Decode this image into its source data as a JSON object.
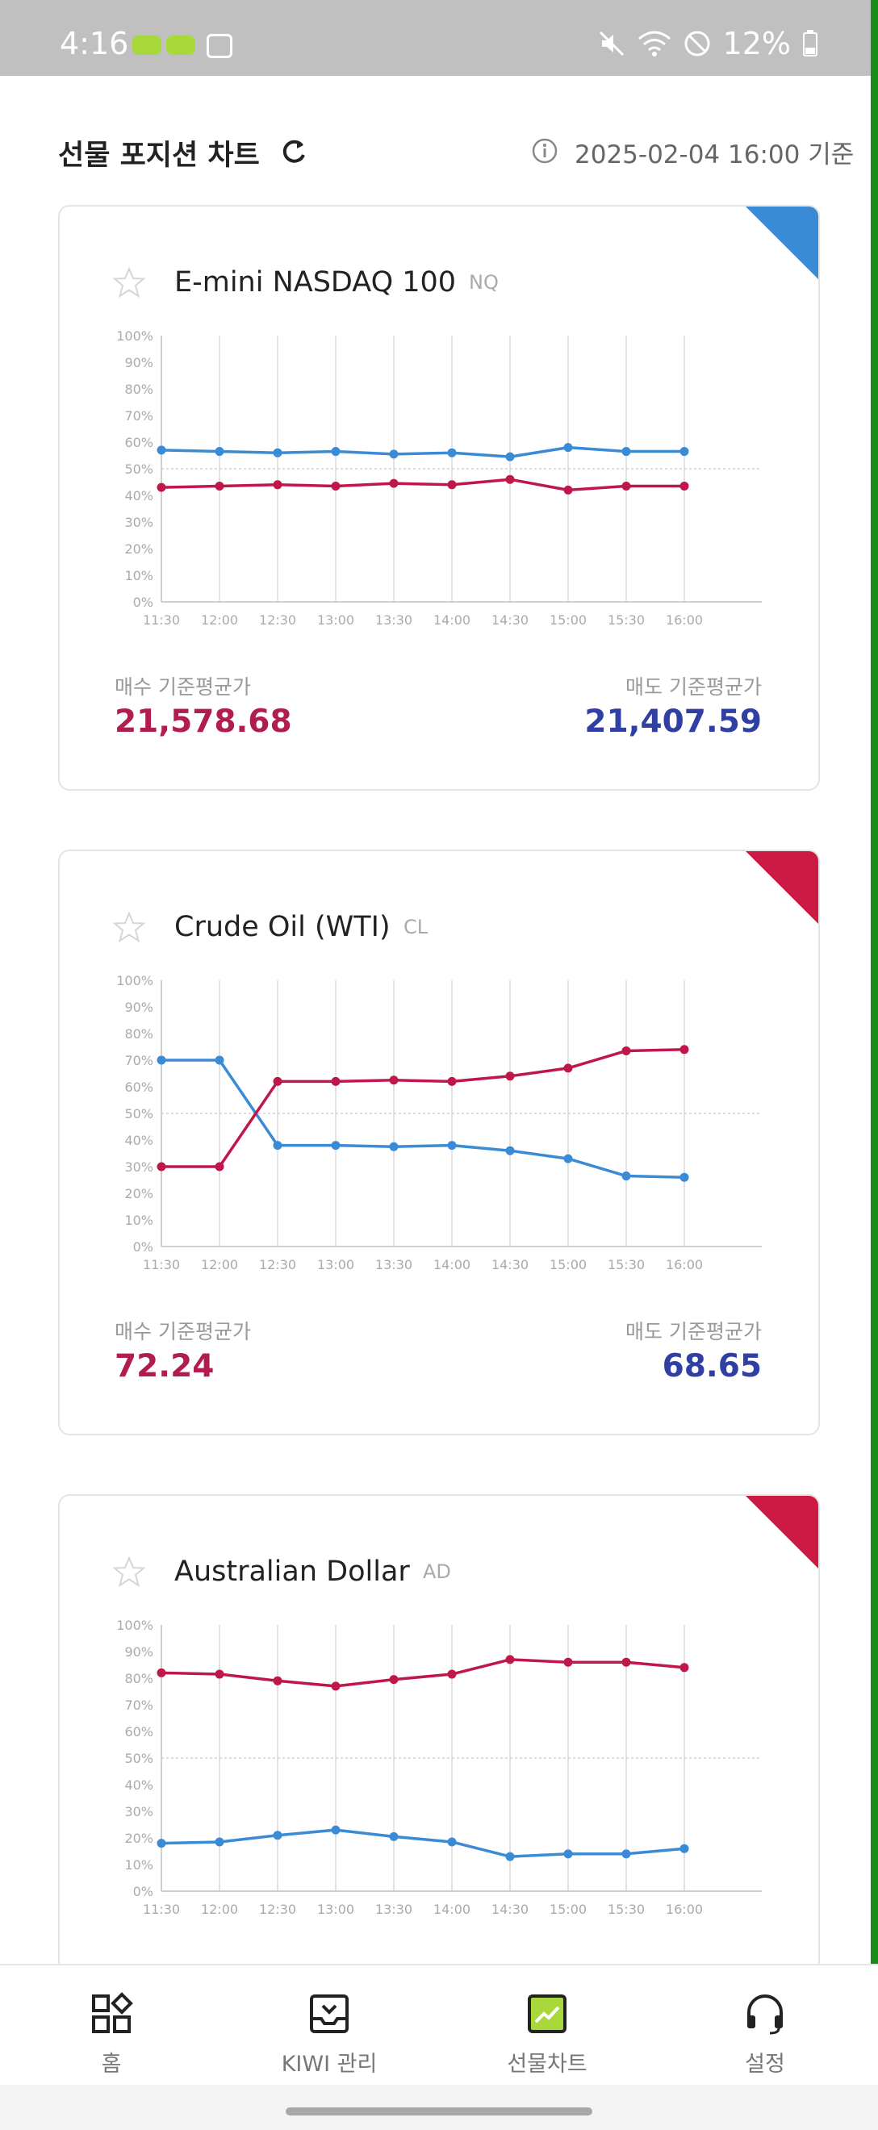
{
  "status_bar": {
    "time": "4:16",
    "battery": "12%"
  },
  "header": {
    "title": "선물 포지션 차트",
    "timestamp": "2025-02-04 16:00 기준"
  },
  "labels": {
    "buy": "매수 기준평균가",
    "sell": "매도 기준평균가"
  },
  "cards": [
    {
      "name": "E-mini NASDAQ 100",
      "code": "NQ",
      "corner_color": "#3a8ad6",
      "buy_value": "21,578.68",
      "sell_value": "21,407.59"
    },
    {
      "name": "Crude Oil (WTI)",
      "code": "CL",
      "corner_color": "#cc1a44",
      "buy_value": "72.24",
      "sell_value": "68.65"
    },
    {
      "name": "Australian Dollar",
      "code": "AD",
      "corner_color": "#cc1a44"
    }
  ],
  "chart_data": [
    {
      "type": "line",
      "x": [
        "11:30",
        "12:00",
        "12:30",
        "13:00",
        "13:30",
        "14:00",
        "14:30",
        "15:00",
        "15:30",
        "16:00"
      ],
      "yticks": [
        "0%",
        "10%",
        "20%",
        "30%",
        "40%",
        "50%",
        "60%",
        "70%",
        "80%",
        "90%",
        "100%"
      ],
      "ylim": [
        0,
        100
      ],
      "series": [
        {
          "color": "#3a8ad6",
          "values": [
            57,
            56.5,
            56,
            56.5,
            55.5,
            56,
            54.5,
            58,
            56.5,
            56.5
          ]
        },
        {
          "color": "#c0174a",
          "values": [
            43,
            43.5,
            44,
            43.5,
            44.5,
            44,
            46,
            42,
            43.5,
            43.5
          ]
        }
      ]
    },
    {
      "type": "line",
      "x": [
        "11:30",
        "12:00",
        "12:30",
        "13:00",
        "13:30",
        "14:00",
        "14:30",
        "15:00",
        "15:30",
        "16:00"
      ],
      "yticks": [
        "0%",
        "10%",
        "20%",
        "30%",
        "40%",
        "50%",
        "60%",
        "70%",
        "80%",
        "90%",
        "100%"
      ],
      "ylim": [
        0,
        100
      ],
      "series": [
        {
          "color": "#3a8ad6",
          "values": [
            70,
            70,
            38,
            38,
            37.5,
            38,
            36,
            33,
            26.5,
            26
          ]
        },
        {
          "color": "#c0174a",
          "values": [
            30,
            30,
            62,
            62,
            62.5,
            62,
            64,
            67,
            73.5,
            74
          ]
        }
      ]
    },
    {
      "type": "line",
      "x": [
        "11:30",
        "12:00",
        "12:30",
        "13:00",
        "13:30",
        "14:00",
        "14:30",
        "15:00",
        "15:30",
        "16:00"
      ],
      "yticks": [
        "0%",
        "10%",
        "20%",
        "30%",
        "40%",
        "50%",
        "60%",
        "70%",
        "80%",
        "90%",
        "100%"
      ],
      "ylim": [
        0,
        100
      ],
      "series": [
        {
          "color": "#3a8ad6",
          "values": [
            18,
            18.5,
            21,
            23,
            20.5,
            18.5,
            13,
            14,
            14,
            16
          ]
        },
        {
          "color": "#c0174a",
          "values": [
            82,
            81.5,
            79,
            77,
            79.5,
            81.5,
            87,
            86,
            86,
            84
          ]
        }
      ]
    }
  ],
  "nav": [
    {
      "label": "홈"
    },
    {
      "label": "KIWI 관리"
    },
    {
      "label": "선물차트",
      "active_color": "#a8d83a"
    },
    {
      "label": "설정"
    }
  ]
}
